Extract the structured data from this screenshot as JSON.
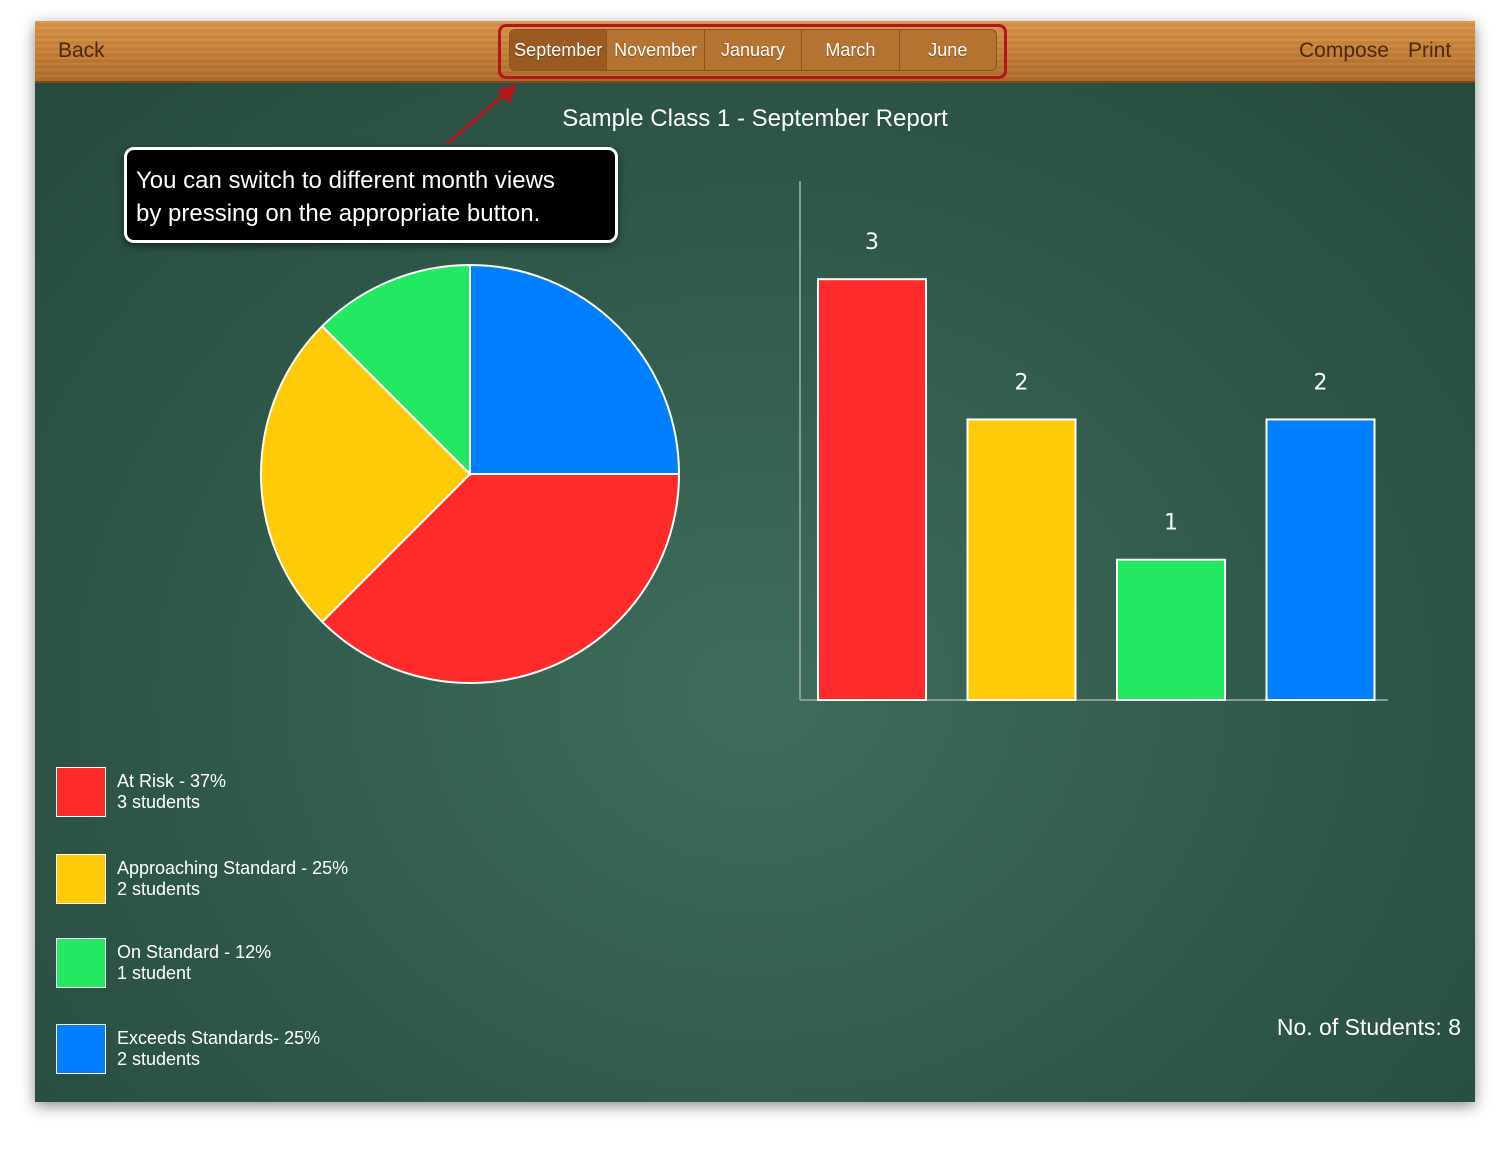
{
  "toolbar": {
    "back_label": "Back",
    "compose_label": "Compose",
    "print_label": "Print",
    "months": [
      "September",
      "November",
      "January",
      "March",
      "June"
    ],
    "active_month": "September"
  },
  "report": {
    "title": "Sample Class 1 - September Report"
  },
  "callout": {
    "text_line1": "You can switch to different month views",
    "text_line2": "by pressing on the appropriate button."
  },
  "colors": {
    "at_risk": "#ff2b2b",
    "approaching": "#ffca08",
    "on_standard": "#23e862",
    "exceeds": "#0080ff",
    "callout_highlight": "#b3151b"
  },
  "chart_data": [
    {
      "type": "pie",
      "categories": [
        "At Risk",
        "Approaching Standard",
        "On Standard",
        "Exceeds Standards"
      ],
      "values": [
        3,
        2,
        1,
        2
      ],
      "colors": [
        "#ff2b2b",
        "#ffca08",
        "#23e862",
        "#0080ff"
      ]
    },
    {
      "type": "bar",
      "categories": [
        "At Risk",
        "Approaching Standard",
        "On Standard",
        "Exceeds Standards"
      ],
      "values": [
        3,
        2,
        1,
        2
      ],
      "data_labels": [
        "3",
        "2",
        "1",
        "2"
      ],
      "colors": [
        "#ff2b2b",
        "#ffca08",
        "#23e862",
        "#0080ff"
      ],
      "ylim": [
        0,
        3.7
      ]
    }
  ],
  "legend": [
    {
      "label": "At Risk - 37%",
      "count": "3 students",
      "color": "#ff2b2b"
    },
    {
      "label": "Approaching Standard - 25%",
      "count": "2 students",
      "color": "#ffca08"
    },
    {
      "label": "On Standard - 12%",
      "count": "1 student",
      "color": "#23e862"
    },
    {
      "label": "Exceeds Standards- 25%",
      "count": "2 students",
      "color": "#0080ff"
    }
  ],
  "summary": {
    "student_count_text": "No. of Students: 8"
  }
}
